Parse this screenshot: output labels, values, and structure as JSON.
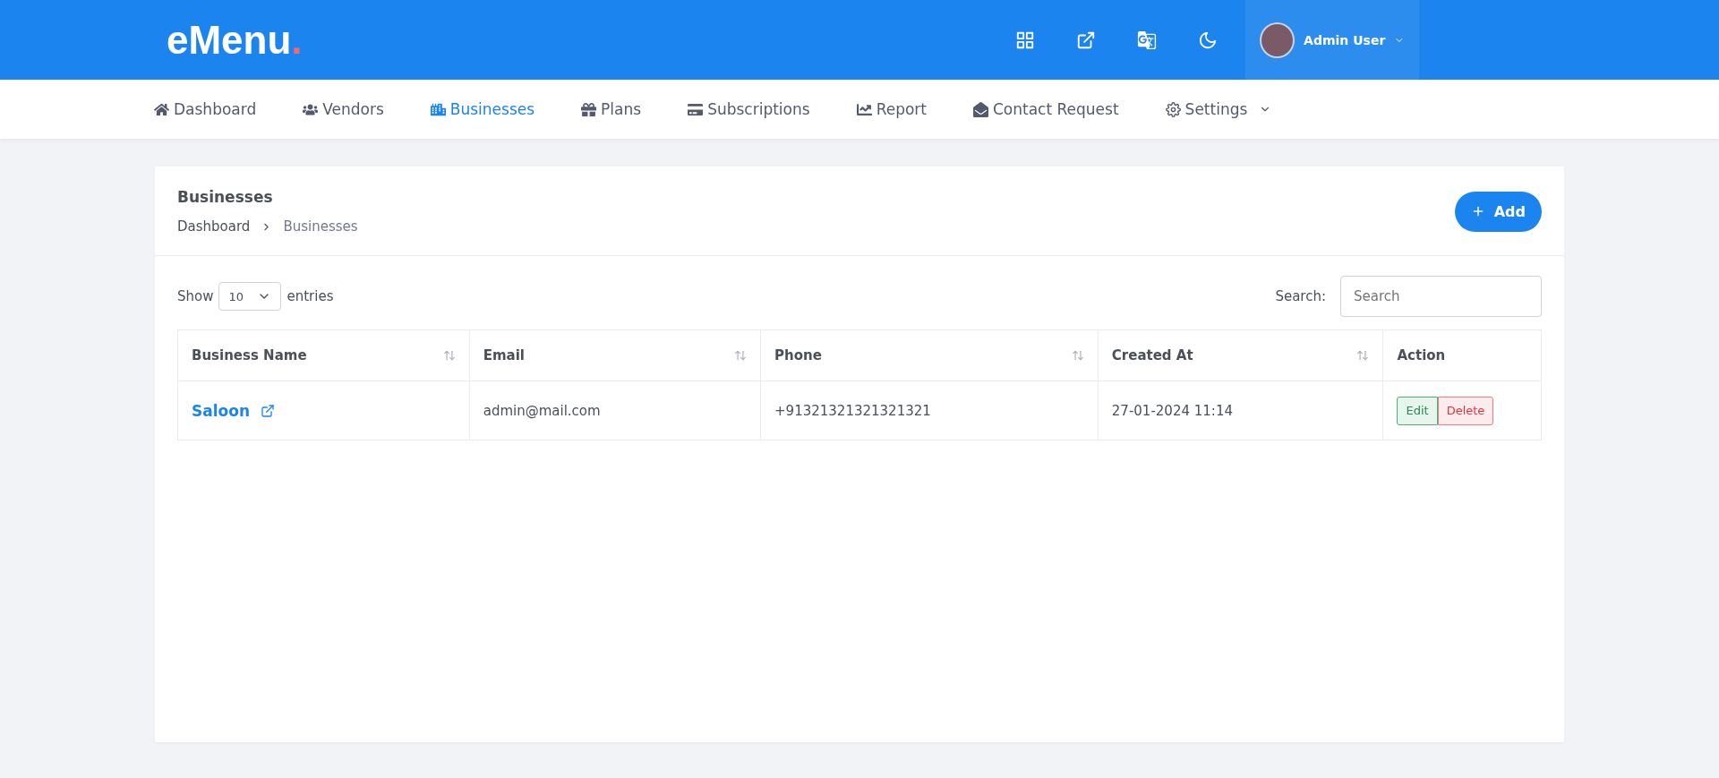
{
  "logo": {
    "text": "eMenu",
    "dot": "."
  },
  "user": {
    "name": "Admin User"
  },
  "nav": [
    {
      "label": "Dashboard",
      "kind": "link",
      "selected": false
    },
    {
      "label": "Vendors",
      "kind": "link",
      "selected": false
    },
    {
      "label": "Businesses",
      "kind": "link",
      "selected": true
    },
    {
      "label": "Plans",
      "kind": "link",
      "selected": false
    },
    {
      "label": "Subscriptions",
      "kind": "link",
      "selected": false
    },
    {
      "label": "Report",
      "kind": "link",
      "selected": false
    },
    {
      "label": "Contact Request",
      "kind": "link",
      "selected": false
    },
    {
      "label": "Settings",
      "kind": "dropdown",
      "selected": false
    }
  ],
  "page": {
    "title": "Businesses",
    "breadcrumb": [
      "Dashboard",
      "Businesses"
    ],
    "add_button": "Add"
  },
  "length": {
    "show": "Show",
    "value": "10",
    "entries": "entries"
  },
  "search": {
    "label": "Search:",
    "placeholder": "Search"
  },
  "table": {
    "columns": [
      {
        "label": "Business Name",
        "sortable": true
      },
      {
        "label": "Email",
        "sortable": true
      },
      {
        "label": "Phone",
        "sortable": true
      },
      {
        "label": "Created At",
        "sortable": true
      },
      {
        "label": "Action",
        "sortable": false
      }
    ],
    "rows": [
      {
        "name": "Saloon",
        "email": "admin@mail.com",
        "phone": "+91321321321321321",
        "created": "27-01-2024 11:14",
        "edit": "Edit",
        "delete": "Delete"
      }
    ]
  }
}
